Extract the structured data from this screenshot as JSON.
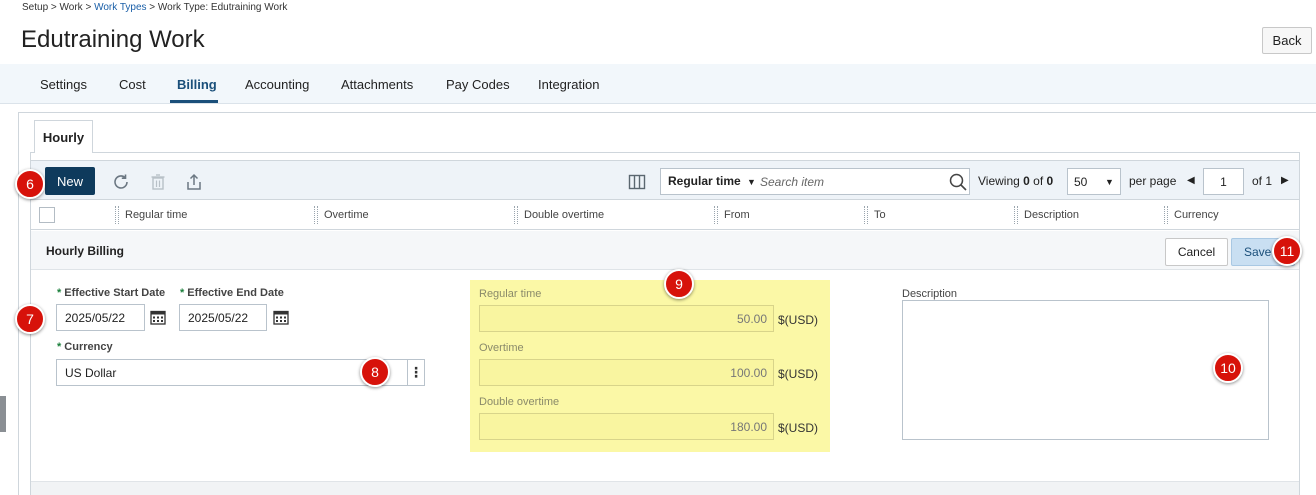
{
  "breadcrumb": {
    "part1": "Setup > Work > ",
    "link": "Work Types",
    "part2": " > Work Type: Edutraining Work"
  },
  "page_title": "Edutraining Work",
  "back_label": "Back",
  "tabs": [
    {
      "label": "Settings"
    },
    {
      "label": "Cost"
    },
    {
      "label": "Billing",
      "active": true
    },
    {
      "label": "Accounting"
    },
    {
      "label": "Attachments"
    },
    {
      "label": "Pay Codes"
    },
    {
      "label": "Integration"
    }
  ],
  "subtab": "Hourly",
  "toolbar": {
    "new_label": "New",
    "search_filter": "Regular time",
    "search_placeholder": "Search item",
    "viewing_prefix": "Viewing ",
    "viewing_count": "0",
    "viewing_of": " of ",
    "viewing_total": "0",
    "per_page_value": "50",
    "per_page_label": "per page",
    "page_value": "1",
    "of_pages": "of 1"
  },
  "columns": [
    "Regular time",
    "Overtime",
    "Double overtime",
    "From",
    "To",
    "Description",
    "Currency"
  ],
  "form": {
    "title": "Hourly Billing",
    "cancel_label": "Cancel",
    "save_label": "Save",
    "effective_start_label": "Effective Start Date",
    "effective_start_value": "2025/05/22",
    "effective_end_label": "Effective End Date",
    "effective_end_value": "2025/05/22",
    "currency_label": "Currency",
    "currency_value": "US Dollar",
    "regular_time_label": "Regular time",
    "regular_time_value": "50.00",
    "overtime_label": "Overtime",
    "overtime_value": "100.00",
    "double_overtime_label": "Double overtime",
    "double_overtime_value": "180.00",
    "unit": "$(USD)",
    "description_label": "Description"
  },
  "markers": [
    "6",
    "7",
    "8",
    "9",
    "10",
    "11"
  ],
  "colors": {
    "primary": "#0e3a5c",
    "accent_blue": "#1a4f7a",
    "highlight_yellow": "#fbf8a6",
    "marker_red": "#d7120a"
  }
}
